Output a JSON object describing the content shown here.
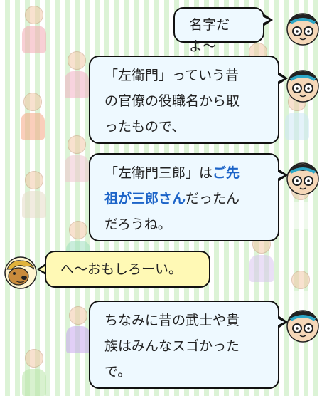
{
  "chat": {
    "messages": [
      {
        "speaker": "boy",
        "text": "名字だよ〜"
      },
      {
        "speaker": "boy",
        "line1": "「左衛門」っていう昔",
        "line2": "の官僚の役職名から取",
        "line3": "ったもので、"
      },
      {
        "speaker": "boy",
        "line1_a": "「左衛門三郎」は",
        "line1_b": "ご先",
        "line2_a": "祖が三郎さん",
        "line2_b": "だったん",
        "line3": "だろうね。"
      },
      {
        "speaker": "dog",
        "text": "へ〜おもしろーい。"
      },
      {
        "speaker": "boy",
        "line1": "ちなみに昔の武士や貴",
        "line2": "族はみんなスゴかった",
        "line3": "で。"
      }
    ]
  },
  "colors": {
    "stripe": "#dcf3d6",
    "boy_bubble": "#eef9ff",
    "dog_bubble": "#fff9b5",
    "highlight": "#1c64c8"
  },
  "icons": {
    "boy_avatar": "boy-with-glasses-icon",
    "dog_avatar": "dog-icon"
  }
}
